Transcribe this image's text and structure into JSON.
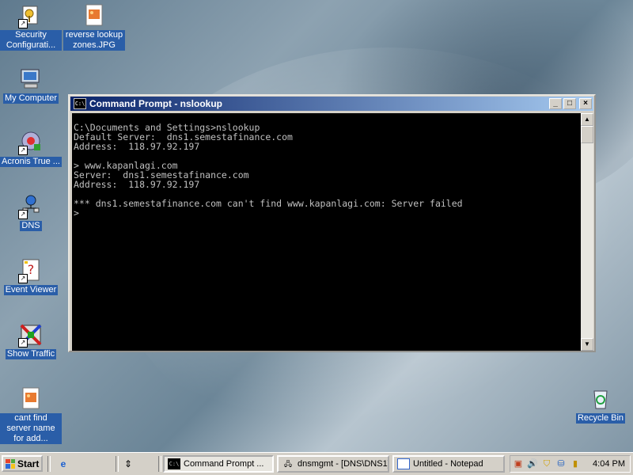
{
  "desktop": {
    "icons": [
      {
        "label": "Security Configurati..."
      },
      {
        "label": "reverse lookup zones.JPG"
      },
      {
        "label": "My Computer"
      },
      {
        "label": "Acronis True ..."
      },
      {
        "label": "DNS"
      },
      {
        "label": "Event Viewer"
      },
      {
        "label": "Show Traffic"
      },
      {
        "label": "cant find server name for add..."
      },
      {
        "label": "Recycle Bin"
      }
    ]
  },
  "cmd_window": {
    "title": "Command Prompt - nslookup",
    "buttons": {
      "minimize": "_",
      "maximize": "□",
      "close": "×"
    },
    "lines": [
      "C:\\Documents and Settings>nslookup",
      "Default Server:  dns1.semestafinance.com",
      "Address:  118.97.92.197",
      "",
      "> www.kapanlagi.com",
      "Server:  dns1.semestafinance.com",
      "Address:  118.97.92.197",
      "",
      "*** dns1.semestafinance.com can't find www.kapanlagi.com: Server failed",
      ">"
    ]
  },
  "taskbar": {
    "start_label": "Start",
    "tasks": [
      {
        "label": "Command Prompt ...",
        "active": true
      },
      {
        "label": "dnsmgmt - [DNS\\DNS1]",
        "active": false
      },
      {
        "label": "Untitled - Notepad",
        "active": false
      }
    ],
    "clock": "4:04 PM"
  },
  "colors": {
    "title_active_start": "#0a246a",
    "title_active_end": "#a6caf0",
    "console_bg": "#000000",
    "console_fg": "#c0c0c0"
  }
}
